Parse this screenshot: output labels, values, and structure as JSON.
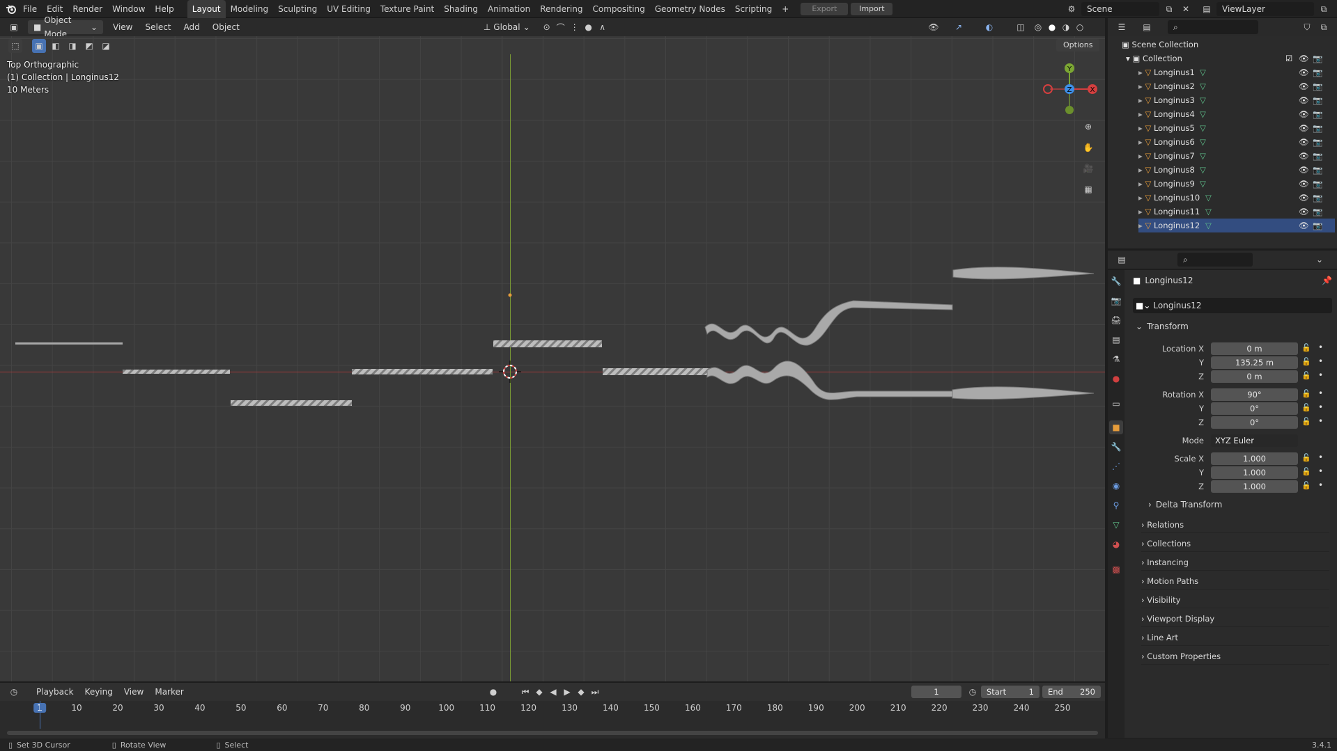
{
  "app": {
    "logo": "blender-logo-icon",
    "version": "3.4.1"
  },
  "menu": [
    "File",
    "Edit",
    "Render",
    "Window",
    "Help"
  ],
  "workspaces": [
    "Layout",
    "Modeling",
    "Sculpting",
    "UV Editing",
    "Texture Paint",
    "Shading",
    "Animation",
    "Rendering",
    "Compositing",
    "Geometry Nodes",
    "Scripting"
  ],
  "active_workspace": "Layout",
  "topbar": {
    "export": "Export",
    "import": "Import",
    "scene": "Scene",
    "view_layer": "ViewLayer"
  },
  "viewport_header": {
    "mode": "Object Mode",
    "menus": [
      "View",
      "Select",
      "Add",
      "Object"
    ],
    "orientation": "Global",
    "options": "Options"
  },
  "viewport_overlay": {
    "view_name": "Top Orthographic",
    "collection_line": "(1) Collection | Longinus12",
    "scale": "10 Meters"
  },
  "gizmo": {
    "x": "X",
    "y": "Y",
    "z": "Z"
  },
  "outliner": {
    "root": "Scene Collection",
    "collection": "Collection",
    "objects": [
      "Longinus1",
      "Longinus2",
      "Longinus3",
      "Longinus4",
      "Longinus5",
      "Longinus6",
      "Longinus7",
      "Longinus8",
      "Longinus9",
      "Longinus10",
      "Longinus11",
      "Longinus12"
    ]
  },
  "properties": {
    "object_name": "Longinus12",
    "data_name": "Longinus12",
    "transform_title": "Transform",
    "location_label": "Location X",
    "location": {
      "x": "0 m",
      "y": "135.25 m",
      "z": "0 m"
    },
    "rotation_label": "Rotation X",
    "rotation": {
      "x": "90°",
      "y": "0°",
      "z": "0°"
    },
    "mode_label": "Mode",
    "mode": "XYZ Euler",
    "scale_label": "Scale X",
    "scale": {
      "x": "1.000",
      "y": "1.000",
      "z": "1.000"
    },
    "axis_y": "Y",
    "axis_z": "Z",
    "delta": "Delta Transform",
    "panels": [
      "Relations",
      "Collections",
      "Instancing",
      "Motion Paths",
      "Visibility",
      "Viewport Display",
      "Line Art",
      "Custom Properties"
    ]
  },
  "timeline": {
    "menus": [
      "Playback",
      "Keying",
      "View",
      "Marker"
    ],
    "current_frame": "1",
    "start_label": "Start",
    "start": "1",
    "end_label": "End",
    "end": "250",
    "ticks": [
      "1",
      "10",
      "20",
      "30",
      "40",
      "50",
      "60",
      "70",
      "80",
      "90",
      "100",
      "110",
      "120",
      "130",
      "140",
      "150",
      "160",
      "170",
      "180",
      "190",
      "200",
      "210",
      "220",
      "230",
      "240",
      "250"
    ]
  },
  "status": {
    "left": "Set 3D Cursor",
    "middle": "Rotate View",
    "right": "Select"
  },
  "colors": {
    "accent": "#4772b3",
    "x_axis": "#d43f3f",
    "y_axis": "#7ba633",
    "z_axis": "#3d8ee6",
    "object_orange": "#e79d3b",
    "mesh_green": "#5fc28b"
  }
}
